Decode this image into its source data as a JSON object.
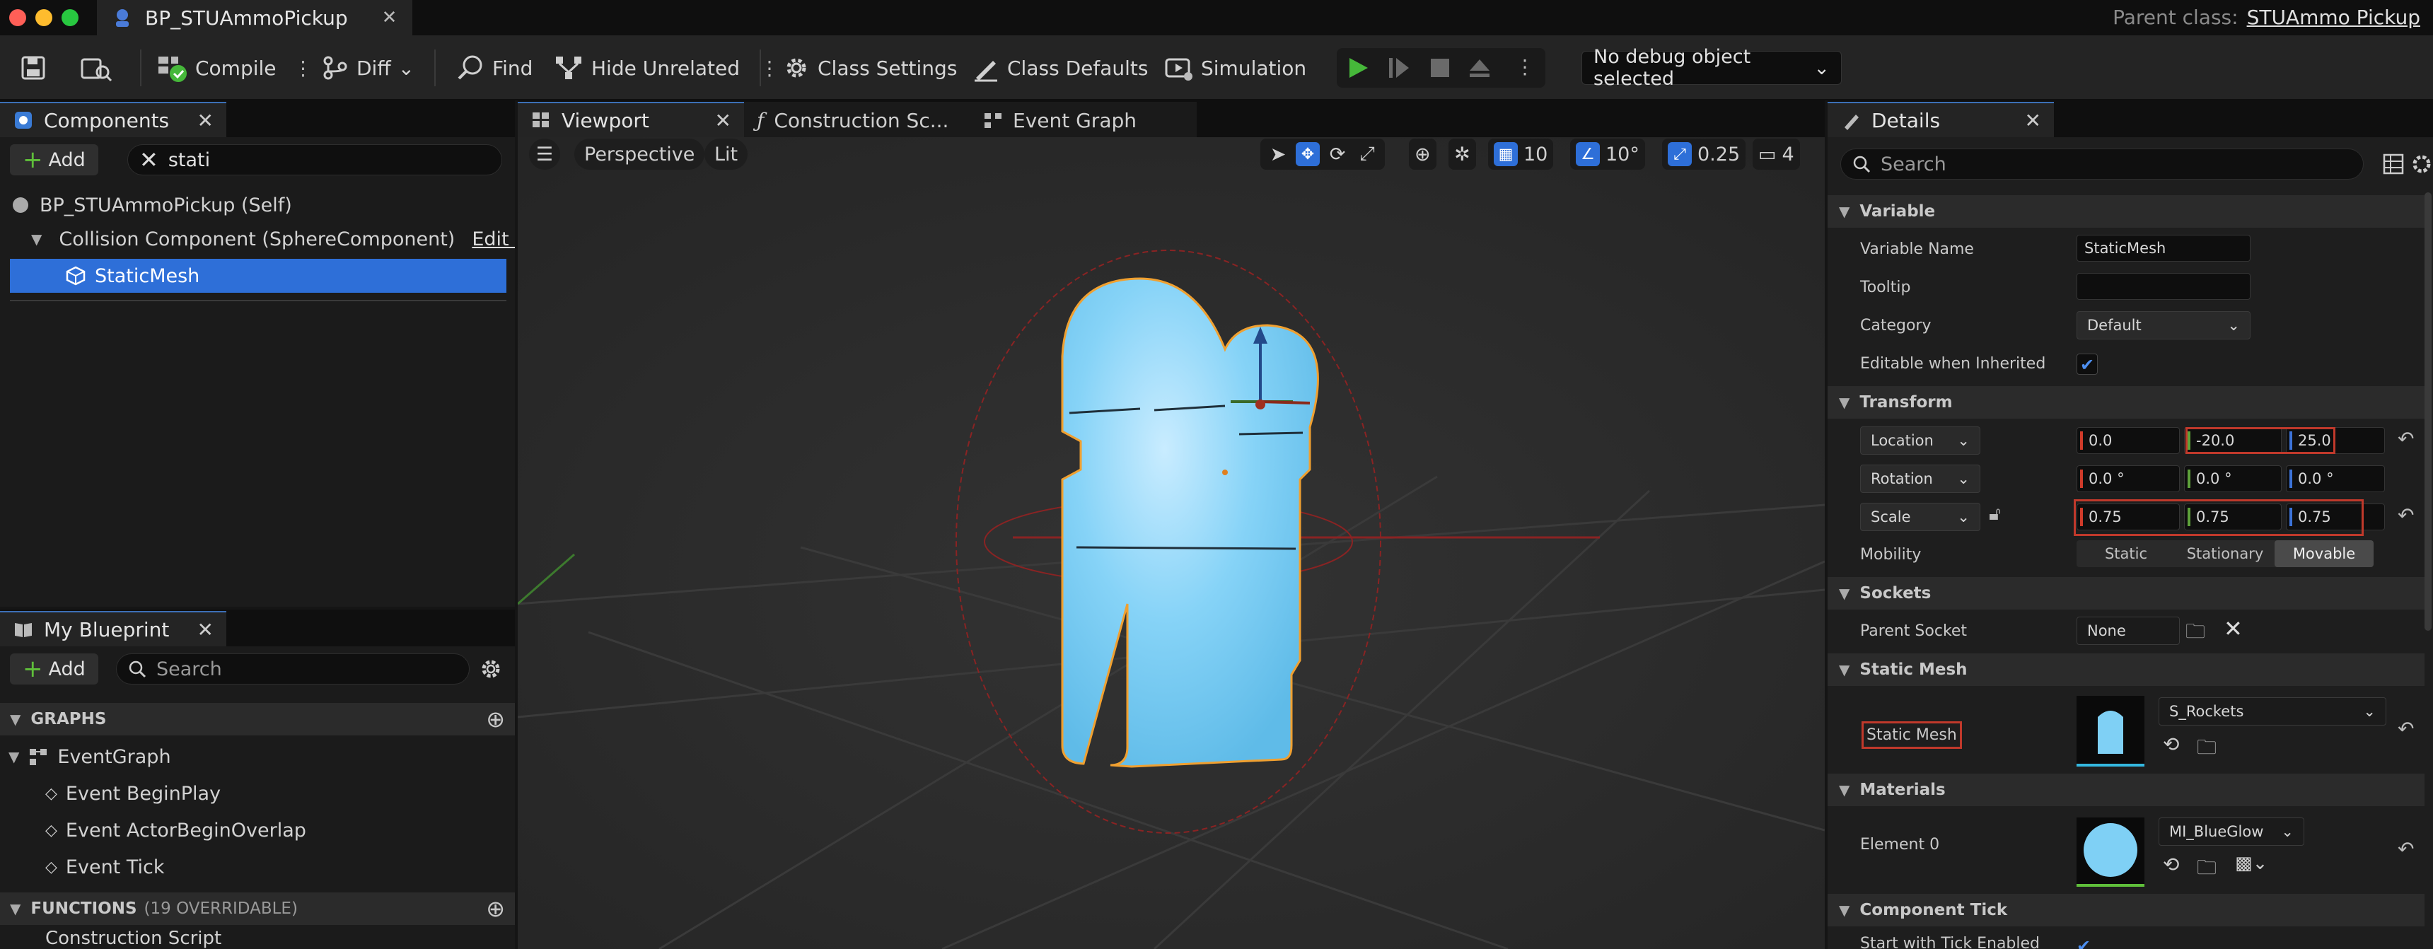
{
  "titlebar": {
    "tab_title": "BP_STUAmmoPickup",
    "close": "✕",
    "parent_class_label": "Parent class:",
    "parent_class_value": "STUAmmo Pickup"
  },
  "toolbar": {
    "compile": "Compile",
    "diff": "Diff",
    "find": "Find",
    "hide_unrelated": "Hide Unrelated",
    "class_settings": "Class Settings",
    "class_defaults": "Class Defaults",
    "simulation": "Simulation",
    "debug_object": "No debug object selected"
  },
  "components": {
    "tab": "Components",
    "add": "Add",
    "search_value": "stati",
    "items": [
      "BP_STUAmmoPickup (Self)",
      "Collision Component (SphereComponent)",
      "StaticMesh"
    ],
    "edit_in": "Edit in C"
  },
  "my_blueprint": {
    "tab": "My Blueprint",
    "add": "Add",
    "search_placeholder": "Search",
    "graphs_header": "GRAPHS",
    "event_graph": "EventGraph",
    "events": [
      "Event BeginPlay",
      "Event ActorBeginOverlap",
      "Event Tick"
    ],
    "functions_header": "FUNCTIONS",
    "functions_count": "(19 OVERRIDABLE)",
    "construction_script": "Construction Script"
  },
  "editor_tabs": {
    "viewport": "Viewport",
    "construction": "Construction Sc...",
    "event_graph": "Event Graph"
  },
  "viewport": {
    "perspective": "Perspective",
    "lit": "Lit",
    "grid_snap": "10",
    "rot_snap": "10°",
    "scale_snap": "0.25",
    "camera_speed": "4"
  },
  "details": {
    "tab": "Details",
    "search_placeholder": "Search",
    "sections": {
      "variable": "Variable",
      "transform": "Transform",
      "sockets": "Sockets",
      "static_mesh": "Static Mesh",
      "materials": "Materials",
      "component_tick": "Component Tick"
    },
    "variable_name_label": "Variable Name",
    "variable_name": "StaticMesh",
    "tooltip_label": "Tooltip",
    "tooltip": "",
    "category_label": "Category",
    "category": "Default",
    "editable_label": "Editable when Inherited",
    "location_label": "Location",
    "location": [
      "0.0",
      "-20.0",
      "25.0"
    ],
    "rotation_label": "Rotation",
    "rotation": [
      "0.0 °",
      "0.0 °",
      "0.0 °"
    ],
    "scale_label": "Scale",
    "scale": [
      "0.75",
      "0.75",
      "0.75"
    ],
    "mobility_label": "Mobility",
    "mobility_options": [
      "Static",
      "Stationary",
      "Movable"
    ],
    "mobility_selected": "Movable",
    "parent_socket_label": "Parent Socket",
    "parent_socket": "None",
    "static_mesh_label": "Static Mesh",
    "static_mesh_value": "S_Rockets",
    "element0_label": "Element 0",
    "material_value": "MI_BlueGlow",
    "tick_label": "Start with Tick Enabled"
  },
  "colors": {
    "accent_blue": "#2e6fd8",
    "selection": "#2e6fd8",
    "mesh": "#7fd0f5",
    "highlight_red": "#c0392b",
    "play_green": "#46b83a"
  }
}
